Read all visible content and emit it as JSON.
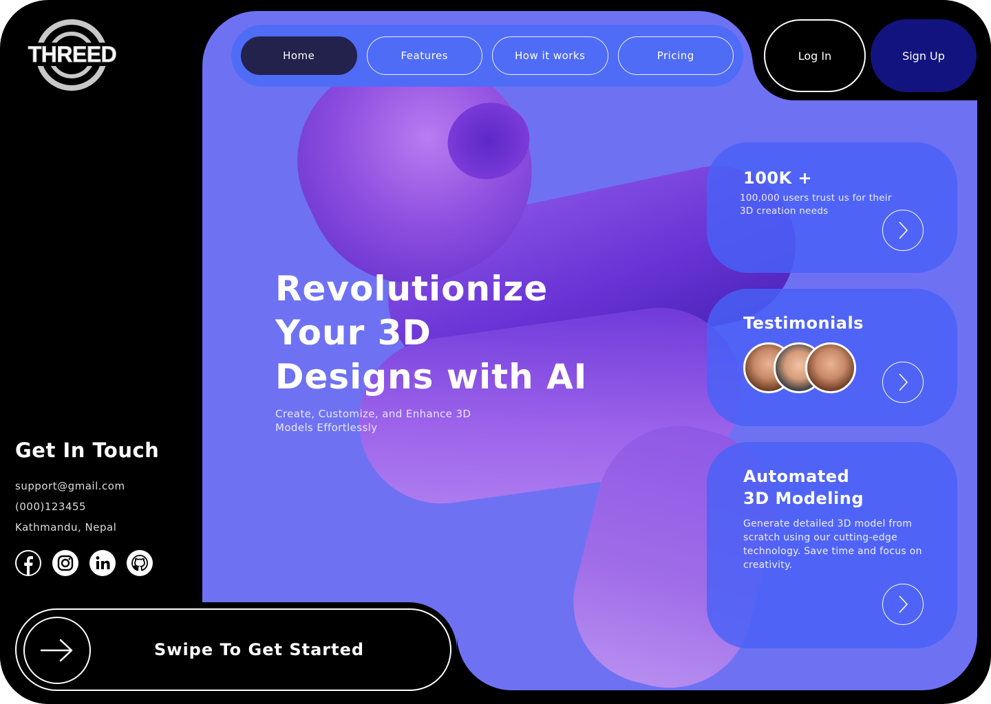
{
  "brand": {
    "logo_text": "THREED"
  },
  "nav": {
    "items": [
      {
        "label": "Home",
        "active": true
      },
      {
        "label": "Features",
        "active": false
      },
      {
        "label": "How it works",
        "active": false
      },
      {
        "label": "Pricing",
        "active": false
      }
    ]
  },
  "auth": {
    "login_label": "Log In",
    "signup_label": "Sign Up"
  },
  "hero": {
    "title_lines": [
      "Revolutionize",
      "Your 3D",
      "Designs with AI"
    ],
    "subtitle": "Create, Customize, and Enhance 3D Models Effortlessly"
  },
  "contact": {
    "title": "Get In Touch",
    "email": "support@gmail.com",
    "phone": "(000)123455",
    "location": "Kathmandu, Nepal",
    "socials": [
      "facebook-icon",
      "instagram-icon",
      "linkedin-icon",
      "github-icon"
    ]
  },
  "swipe": {
    "label": "Swipe To Get Started"
  },
  "cards": {
    "users": {
      "title": "100K +",
      "text": "100,000 users trust us for their 3D creation needs"
    },
    "testimonials": {
      "title": "Testimonials"
    },
    "modeling": {
      "title_line1": "Automated",
      "title_line2": "3D Modeling",
      "text": "Generate detailed 3D model from scratch using our cutting-edge technology. Save time and focus on creativity."
    }
  },
  "colors": {
    "panel": "#6e72f2",
    "nav_bar": "#4f6cf7",
    "nav_active": "#22224d",
    "signup": "#13137f",
    "card": "#4862f6",
    "background": "#000000"
  }
}
